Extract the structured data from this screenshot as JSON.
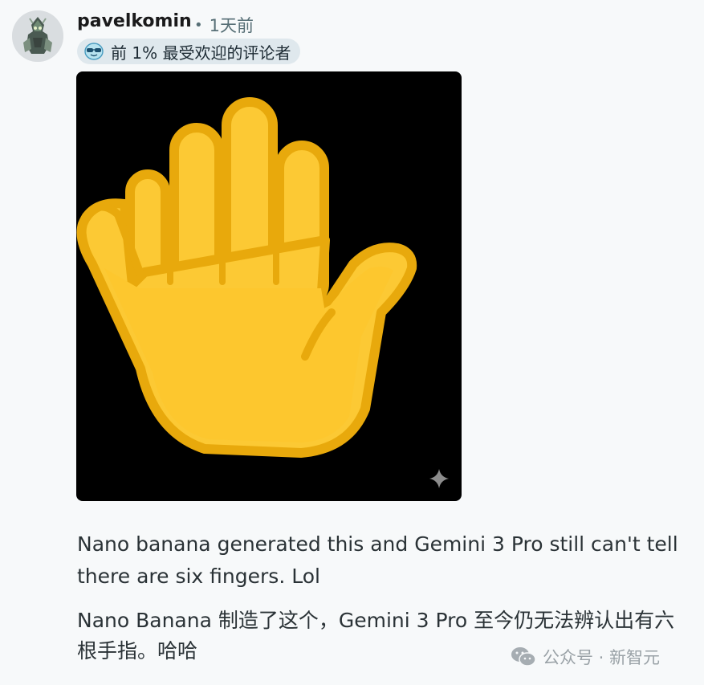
{
  "comment": {
    "username": "pavelkomin",
    "separator": "•",
    "timestamp": "1天前",
    "badge": {
      "icon": "sunglasses-face-icon",
      "label": "前 1% 最受欢迎的评论者"
    },
    "image": {
      "subject": "raised-hand-emoji",
      "overlay_icon": "sparkle-icon"
    },
    "body_en": "Nano banana generated this and Gemini 3 Pro still can't tell there are six fingers. Lol",
    "body_zh": "Nano Banana 制造了这个，Gemini 3 Pro 至今仍无法辨认出有六根手指。哈哈"
  },
  "watermark": {
    "icon": "wechat-icon",
    "label": "公众号 · 新智元"
  },
  "colors": {
    "background": "#f7f9fa",
    "badge_bg": "#dfe8ed",
    "hand_fill": "#fcc934",
    "hand_outline": "#e8a90c",
    "meta_text": "#576f76"
  }
}
